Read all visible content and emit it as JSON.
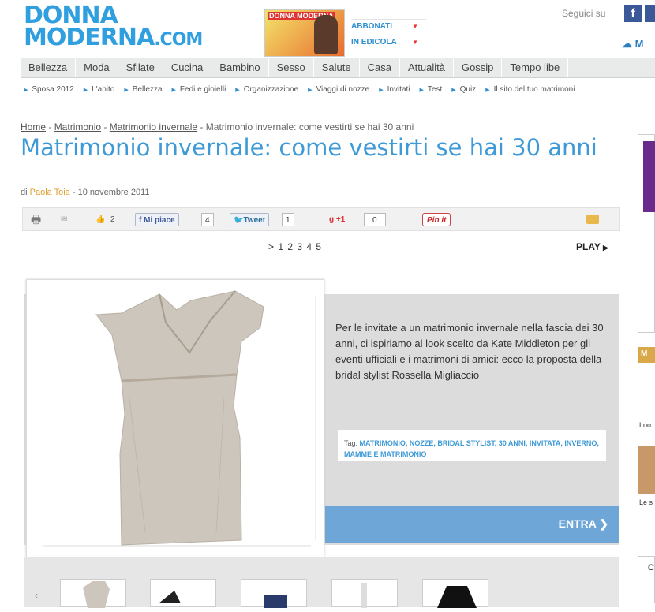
{
  "header": {
    "logo_line1": "DONNA",
    "logo_line2": "MODERNA",
    "logo_suffix": ".COM",
    "magazine_title": "DONNA MODERNA",
    "subscribe_label": "ABBONATI",
    "newsstand_label": "IN EDICOLA",
    "follow_label": "Seguici su",
    "facebook_glyph": "f",
    "weather_label": "M"
  },
  "nav": [
    "Bellezza",
    "Moda",
    "Sfilate",
    "Cucina",
    "Bambino",
    "Sesso",
    "Salute",
    "Casa",
    "Attualità",
    "Gossip",
    "Tempo libe"
  ],
  "subnav": [
    "Sposa 2012",
    "L'abito",
    "Bellezza",
    "Fedi e gioielli",
    "Organizzazione",
    "Viaggi di nozze",
    "Invitati",
    "Test",
    "Quiz",
    "Il sito del tuo matrimoni"
  ],
  "breadcrumb": {
    "home": "Home",
    "sep": " - ",
    "level1": "Matrimonio",
    "level2": "Matrimonio invernale",
    "current": "Matrimonio invernale: come vestirti se hai 30 anni"
  },
  "article": {
    "title": "Matrimonio invernale: come vestirti se hai 30 anni",
    "by": "di ",
    "author": "Paola Toia",
    "date": " -  10 novembre 2011",
    "caption": "Per le invitate a un matrimonio invernale nella fascia dei 30 anni, ci ispiriamo al look scelto da Kate Middleton per gli eventi ufficiali e i matrimoni di amici: ecco la proposta della bridal stylist Rossella Migliaccio",
    "tags_label": "Tag:",
    "tags": "MATRIMONIO,  NOZZE,  BRIDAL STYLIST,  30 ANNI,  INVITATA,  INVERNO,  MAMME E MATRIMONIO",
    "enter_label": "ENTRA ❯"
  },
  "share": {
    "like_count": "2",
    "fb_label": "Mi piace",
    "fb_count": "4",
    "tweet_label": "Tweet",
    "tweet_count": "1",
    "gplus_label": "+1",
    "gplus_count": "0",
    "pin_label": "Pin it"
  },
  "pager": {
    "pages": "> 1 2 3 4 5",
    "play_label": "PLAY"
  },
  "sidebar": {
    "box_label": "M",
    "item1": "Loo",
    "item2": "Le s",
    "box2_label": "C"
  },
  "colors": {
    "brand_blue": "#3e9ad6",
    "entra_bar": "#6ea6d8",
    "nav_bg": "#e9eaea"
  }
}
